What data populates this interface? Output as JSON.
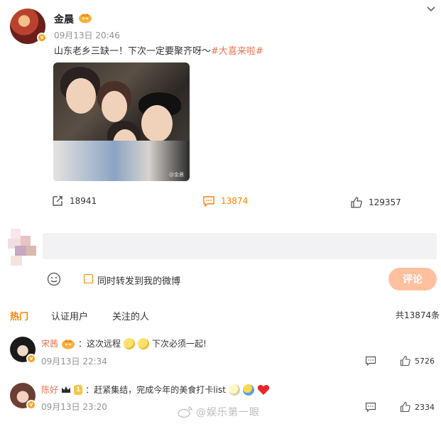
{
  "post": {
    "author": "金晨",
    "timestamp": "09月13日 20:46",
    "text": "山东老乡三缺一！下次一定要聚齐呀～",
    "hashtag": "#大喜来啦#",
    "photo_watermark": "@金晨"
  },
  "actions": {
    "repost_count": "18941",
    "comment_count": "13874",
    "like_count": "129357"
  },
  "compose": {
    "placeholder": "",
    "repost_label": "同时转发到我的微博",
    "submit_label": "评论"
  },
  "tabs": [
    {
      "label": "热门",
      "active": true
    },
    {
      "label": "认证用户",
      "active": false
    },
    {
      "label": "关注的人",
      "active": false
    }
  ],
  "total_comments": "共13874条",
  "comments": [
    {
      "name": "宋茜",
      "text_a": "：这次远程",
      "text_b": "下次必须一起!",
      "time": "09月13日 22:34",
      "likes": "5726"
    },
    {
      "name": "陈好",
      "level": "1",
      "text_a": "：赶紧集结，完成今年的美食打卡list",
      "time": "09月13日 23:20",
      "likes": "2334"
    }
  ],
  "watermark": "@娱乐第一眼",
  "colors": {
    "accent": "#ff8200",
    "link": "#eb7350",
    "submit_bg": "#ffc09f",
    "input_bg": "#f2f2f5"
  }
}
